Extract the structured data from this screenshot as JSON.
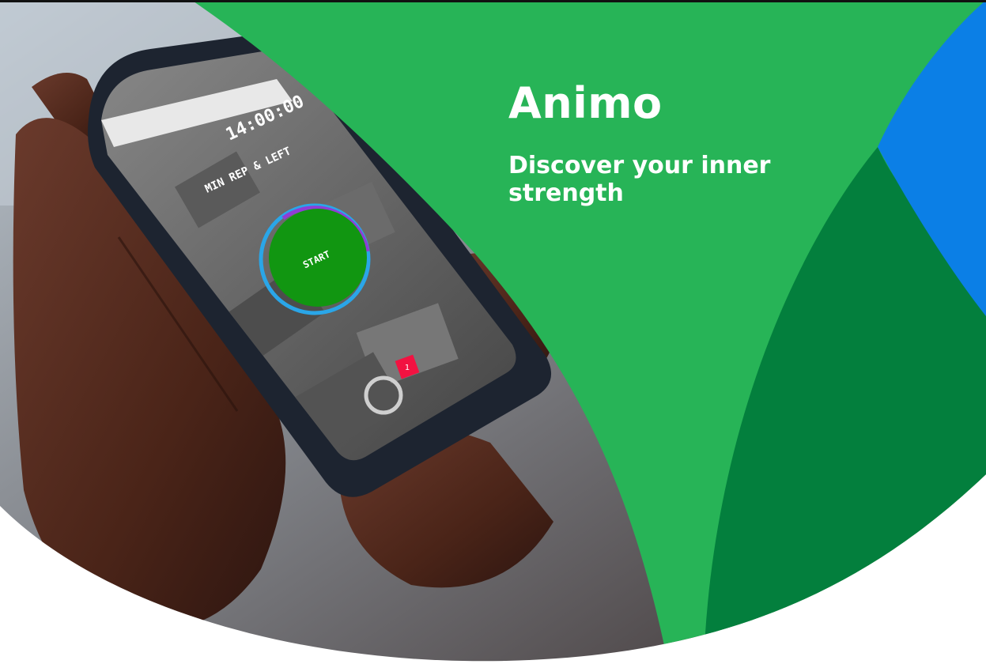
{
  "brand": {
    "title": "Animo",
    "tagline": "Discover your inner strength"
  },
  "phone_screen": {
    "timer": "14:00:00",
    "caption": "MIN REP & LEFT",
    "center_label": "START",
    "marker": "1"
  },
  "colors": {
    "brand_green": "#27b457",
    "dark_green": "#037f3d",
    "accent_blue": "#0b7fe6",
    "app_green": "#119611",
    "app_purple": "#8f3dd6",
    "app_blue": "#2aa6e8",
    "app_red": "#f21241"
  },
  "icons": {
    "photo": "hands-holding-phone-photo",
    "progress_ring": "progress-ring-icon"
  }
}
